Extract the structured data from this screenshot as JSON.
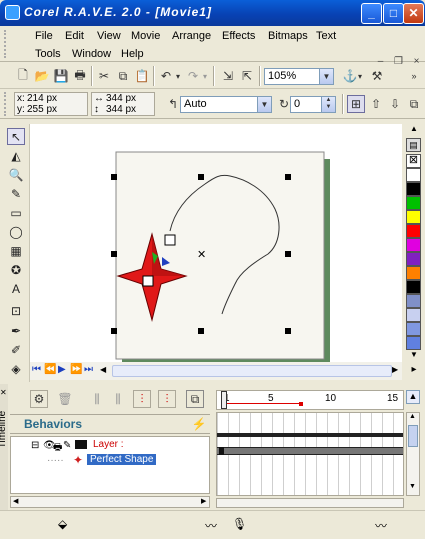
{
  "window": {
    "title": "Corel R.A.V.E. 2.0 - [Movie1]",
    "minimize_label": "_",
    "maximize_label": "□",
    "close_label": "✕",
    "mdi_min": "–",
    "mdi_restore": "❐",
    "mdi_close": "×"
  },
  "menu": {
    "items": [
      "File",
      "Edit",
      "View",
      "Movie",
      "Arrange",
      "Effects",
      "Bitmaps",
      "Text"
    ],
    "items_row2": [
      "Tools",
      "Window",
      "Help"
    ]
  },
  "toolbar": {
    "zoom_value": "105%"
  },
  "propbar": {
    "x_value": "214 px",
    "y_value": "255 px",
    "w_value": "344 px",
    "h_value": "344 px",
    "interp_value": "Auto",
    "rotation_value": "0"
  },
  "timeline": {
    "title": "Timeline",
    "behaviors_label": "Behaviors",
    "layer_label": "Layer :",
    "object_label": "Perfect Shape",
    "ruler_ticks": [
      "1",
      "5",
      "10",
      "15"
    ]
  },
  "palette_colors": [
    "#ffffff",
    "#000000",
    "#00c000",
    "#ffff00",
    "#ff0000",
    "#e000e0",
    "#8020c0",
    "#ff8000",
    "#000000",
    "#8090c8",
    "#c8d0f0",
    "#8098e0",
    "#6080e0",
    "#4070e0"
  ],
  "scene": {
    "star_color": "#e01818",
    "page_shadow_color": "#5e8a5e"
  }
}
